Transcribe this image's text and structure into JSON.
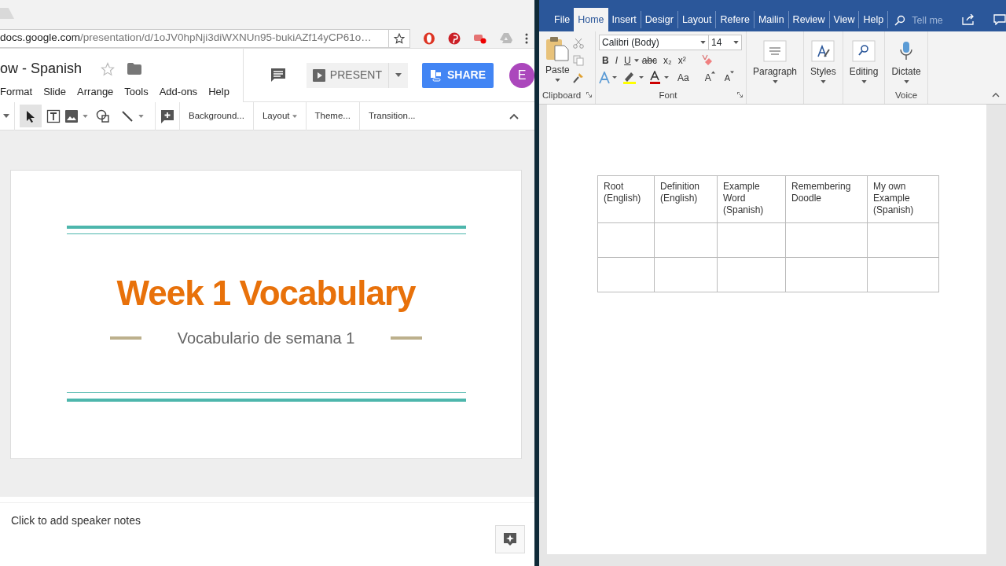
{
  "browser": {
    "host": "docs.google.com",
    "path": "/presentation/d/1oJV0hpNji3diWXNUn95-bukiAZf14yCP61o…"
  },
  "slides_app": {
    "title": "ow - Spanish",
    "menu": [
      "Format",
      "Slide",
      "Arrange",
      "Tools",
      "Add-ons",
      "Help"
    ],
    "present": "PRESENT",
    "share": "SHARE",
    "avatar": "E",
    "toolbar": [
      {
        "label": "Background...",
        "dropdown": false
      },
      {
        "label": "Layout",
        "dropdown": true
      },
      {
        "label": "Theme...",
        "dropdown": false
      },
      {
        "label": "Transition...",
        "dropdown": false
      }
    ]
  },
  "slide": {
    "title": "Week 1 Vocabulary",
    "subtitle": "Vocabulario de semana 1"
  },
  "speaker_notes": {
    "placeholder": "Click to add speaker notes"
  },
  "word": {
    "tabs": [
      {
        "label": "File",
        "selected": false
      },
      {
        "label": "Home",
        "selected": true
      },
      {
        "label": "Insert",
        "selected": false
      },
      {
        "label": "Desigr",
        "selected": false
      },
      {
        "label": "Layout",
        "selected": false
      },
      {
        "label": "Refere",
        "selected": false
      },
      {
        "label": "Mailin",
        "selected": false
      },
      {
        "label": "Review",
        "selected": false
      },
      {
        "label": "View",
        "selected": false
      },
      {
        "label": "Help",
        "selected": false
      }
    ],
    "tell_me": "Tell me",
    "paste": "Paste",
    "clipboard": "Clipboard",
    "font_name": "Calibri (Body)",
    "font_size": "14",
    "format_buttons": [
      "B",
      "I",
      "U",
      "abc",
      "x₂",
      "x²"
    ],
    "case_button": "Aa",
    "grow": "A",
    "shrink": "A",
    "font_group": "Font",
    "big_buttons": [
      "Paragraph",
      "Styles",
      "Editing",
      "Dictate"
    ],
    "voice_group": "Voice",
    "table": {
      "columns": [
        "Root (English)",
        "Definition (English)",
        "Example Word (Spanish)",
        "Remembering Doodle",
        "My own Example (Spanish)"
      ]
    }
  }
}
